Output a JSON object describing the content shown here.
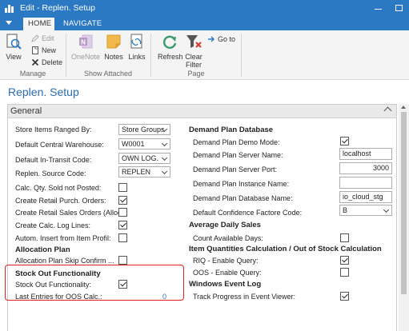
{
  "window": {
    "title": "Edit - Replen. Setup"
  },
  "tabs": [
    {
      "label": "HOME"
    },
    {
      "label": "NAVIGATE"
    }
  ],
  "ribbon": {
    "manage": {
      "label": "Manage",
      "view": "View",
      "edit": "Edit",
      "new": "New",
      "delete": "Delete"
    },
    "show_attached": {
      "label": "Show Attached",
      "onenote": "OneNote",
      "notes": "Notes",
      "links": "Links"
    },
    "page": {
      "label": "Page",
      "refresh": "Refresh",
      "clear_filter_line1": "Clear",
      "clear_filter_line2": "Filter",
      "goto": "Go to"
    }
  },
  "page_title": "Replen. Setup",
  "general": {
    "header": "General",
    "left_fields": [
      {
        "label": "Store Items Ranged By:",
        "type": "dropdown",
        "value": "Store Groups"
      },
      {
        "label": "Default Central Warehouse:",
        "type": "dropdown",
        "value": "W0001"
      },
      {
        "label": "Default In-Transit Code:",
        "type": "dropdown",
        "value": "OWN LOG."
      },
      {
        "label": "Replen. Source Code:",
        "type": "dropdown",
        "value": "REPLEN"
      },
      {
        "label": "Calc. Qty. Sold not Posted:",
        "type": "checkbox",
        "checked": false
      },
      {
        "label": "Create Retail Purch. Orders:",
        "type": "checkbox",
        "checked": true
      },
      {
        "label": "Create Retail Sales Orders (Alloc...",
        "type": "checkbox",
        "checked": false
      },
      {
        "label": "Create Calc. Log Lines:",
        "type": "checkbox",
        "checked": true
      },
      {
        "label": "Autom. Insert from Item Profil:",
        "type": "checkbox",
        "checked": false
      }
    ],
    "allocation_plan": {
      "header": "Allocation Plan",
      "fields": [
        {
          "label": "Allocation Plan Skip Confirm ...",
          "checked": false
        }
      ]
    },
    "stock_out": {
      "header": "Stock Out Functionality",
      "functionality_label": "Stock Out Functionality:",
      "functionality_checked": true,
      "last_entries_label": "Last Entries for OOS Calc.:",
      "last_entries_value": "0"
    },
    "demand_plan": {
      "header": "Demand Plan Database",
      "demo_mode_label": "Demand Plan Demo Mode:",
      "demo_mode_checked": true,
      "server_name_label": "Demand Plan Server Name:",
      "server_name_value": "localhost",
      "server_port_label": "Demand Plan Server Port:",
      "server_port_value": "3000",
      "instance_name_label": "Demand Plan Instance Name:",
      "instance_name_value": "",
      "database_name_label": "Demand Plan Database Name:",
      "database_name_value": "io_cloud_stg",
      "confidence_label": "Default Confidence Factore Code:",
      "confidence_value": "B"
    },
    "avg_daily_sales": {
      "header": "Average Daily Sales",
      "count_days_label": "Count Available Days:",
      "count_days_checked": false
    },
    "item_quantities": {
      "header": "Item Quantities Calculation / Out of Stock Calculation",
      "riq_label": "RIQ - Enable Query:",
      "riq_checked": true,
      "oos_label": "OOS - Enable Query:",
      "oos_checked": false
    },
    "windows_event_log": {
      "header": "Windows Event Log",
      "track_label": "Track Progress in Event Viewer:",
      "track_checked": true
    }
  },
  "colors": {
    "accent": "#2b79c2",
    "title_blue": "#2b6cb0",
    "highlight_red": "#e02020"
  }
}
